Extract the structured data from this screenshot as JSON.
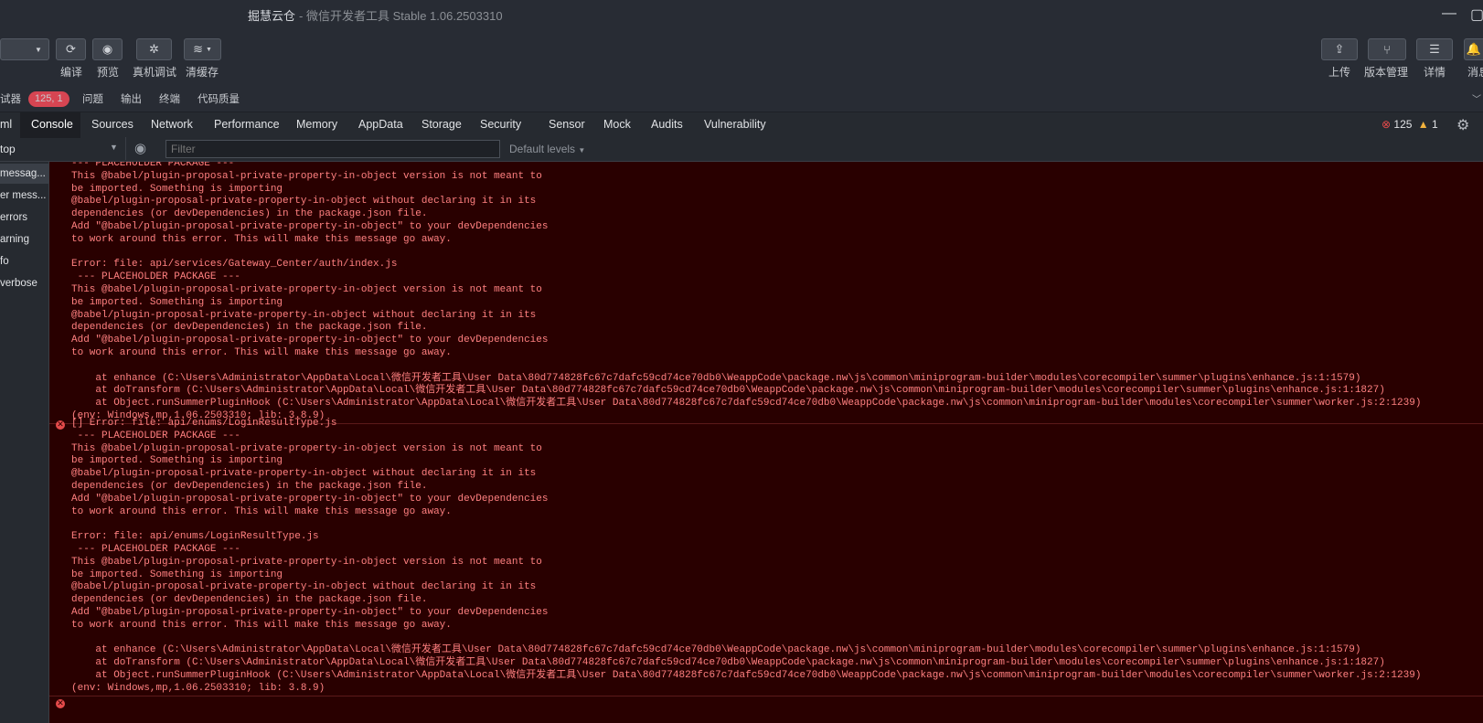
{
  "window": {
    "title": "掘慧云仓",
    "subtitle": "- 微信开发者工具 Stable 1.06.2503310"
  },
  "toolbar": {
    "compile_label": "编译",
    "preview_label": "预览",
    "realdebug_label": "真机调试",
    "clearcache_label": "清缓存",
    "upload_label": "上传",
    "version_label": "版本管理",
    "detail_label": "详情",
    "message_label": "消息"
  },
  "panel_tabs": {
    "debugger": "试器",
    "badge": "125, 1",
    "problems": "问题",
    "output": "输出",
    "terminal": "终端",
    "quality": "代码质量"
  },
  "devtools_tabs": [
    "ml",
    "Console",
    "Sources",
    "Network",
    "Performance",
    "Memory",
    "AppData",
    "Storage",
    "Security",
    "Sensor",
    "Mock",
    "Audits",
    "Vulnerability"
  ],
  "counters": {
    "errors": "125",
    "warnings": "1"
  },
  "filterbar": {
    "context": "top",
    "filter_placeholder": "Filter",
    "levels": "Default levels"
  },
  "sidebar": [
    "messag...",
    "er mess...",
    "errors",
    "arning",
    "fo",
    "verbose"
  ],
  "console": {
    "entry1": "--- PLACEHOLDER PACKAGE ---\nThis @babel/plugin-proposal-private-property-in-object version is not meant to\nbe imported. Something is importing\n@babel/plugin-proposal-private-property-in-object without declaring it in its\ndependencies (or devDependencies) in the package.json file.\nAdd \"@babel/plugin-proposal-private-property-in-object\" to your devDependencies\nto work around this error. This will make this message go away.\n\nError: file: api/services/Gateway_Center/auth/index.js\n --- PLACEHOLDER PACKAGE ---\nThis @babel/plugin-proposal-private-property-in-object version is not meant to\nbe imported. Something is importing\n@babel/plugin-proposal-private-property-in-object without declaring it in its\ndependencies (or devDependencies) in the package.json file.\nAdd \"@babel/plugin-proposal-private-property-in-object\" to your devDependencies\nto work around this error. This will make this message go away.\n\n    at enhance (C:\\Users\\Administrator\\AppData\\Local\\微信开发者工具\\User Data\\80d774828fc67c7dafc59cd74ce70db0\\WeappCode\\package.nw\\js\\common\\miniprogram-builder\\modules\\corecompiler\\summer\\plugins\\enhance.js:1:1579)\n    at doTransform (C:\\Users\\Administrator\\AppData\\Local\\微信开发者工具\\User Data\\80d774828fc67c7dafc59cd74ce70db0\\WeappCode\\package.nw\\js\\common\\miniprogram-builder\\modules\\corecompiler\\summer\\plugins\\enhance.js:1:1827)\n    at Object.runSummerPluginHook (C:\\Users\\Administrator\\AppData\\Local\\微信开发者工具\\User Data\\80d774828fc67c7dafc59cd74ce70db0\\WeappCode\\package.nw\\js\\common\\miniprogram-builder\\modules\\corecompiler\\summer\\worker.js:2:1239)\n(env: Windows,mp,1.06.2503310; lib: 3.8.9)",
    "entry2": "[] Error: file: api/enums/LoginResultType.js\n --- PLACEHOLDER PACKAGE ---\nThis @babel/plugin-proposal-private-property-in-object version is not meant to\nbe imported. Something is importing\n@babel/plugin-proposal-private-property-in-object without declaring it in its\ndependencies (or devDependencies) in the package.json file.\nAdd \"@babel/plugin-proposal-private-property-in-object\" to your devDependencies\nto work around this error. This will make this message go away.\n\nError: file: api/enums/LoginResultType.js\n --- PLACEHOLDER PACKAGE ---\nThis @babel/plugin-proposal-private-property-in-object version is not meant to\nbe imported. Something is importing\n@babel/plugin-proposal-private-property-in-object without declaring it in its\ndependencies (or devDependencies) in the package.json file.\nAdd \"@babel/plugin-proposal-private-property-in-object\" to your devDependencies\nto work around this error. This will make this message go away.\n\n    at enhance (C:\\Users\\Administrator\\AppData\\Local\\微信开发者工具\\User Data\\80d774828fc67c7dafc59cd74ce70db0\\WeappCode\\package.nw\\js\\common\\miniprogram-builder\\modules\\corecompiler\\summer\\plugins\\enhance.js:1:1579)\n    at doTransform (C:\\Users\\Administrator\\AppData\\Local\\微信开发者工具\\User Data\\80d774828fc67c7dafc59cd74ce70db0\\WeappCode\\package.nw\\js\\common\\miniprogram-builder\\modules\\corecompiler\\summer\\plugins\\enhance.js:1:1827)\n    at Object.runSummerPluginHook (C:\\Users\\Administrator\\AppData\\Local\\微信开发者工具\\User Data\\80d774828fc67c7dafc59cd74ce70db0\\WeappCode\\package.nw\\js\\common\\miniprogram-builder\\modules\\corecompiler\\summer\\worker.js:2:1239)\n(env: Windows,mp,1.06.2503310; lib: 3.8.9)"
  }
}
